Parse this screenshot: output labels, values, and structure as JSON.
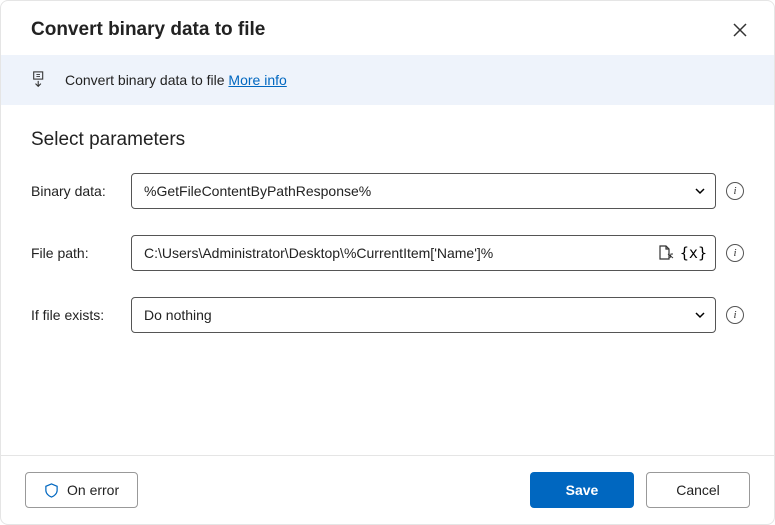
{
  "header": {
    "title": "Convert binary data to file"
  },
  "banner": {
    "text": "Convert binary data to file",
    "link_text": "More info"
  },
  "section": {
    "title": "Select parameters"
  },
  "fields": {
    "binary_data": {
      "label": "Binary data:",
      "value": "%GetFileContentByPathResponse%"
    },
    "file_path": {
      "label": "File path:",
      "value": "C:\\Users\\Administrator\\Desktop\\%CurrentItem['Name']%"
    },
    "if_exists": {
      "label": "If file exists:",
      "value": "Do nothing"
    }
  },
  "footer": {
    "on_error": "On error",
    "save": "Save",
    "cancel": "Cancel"
  }
}
